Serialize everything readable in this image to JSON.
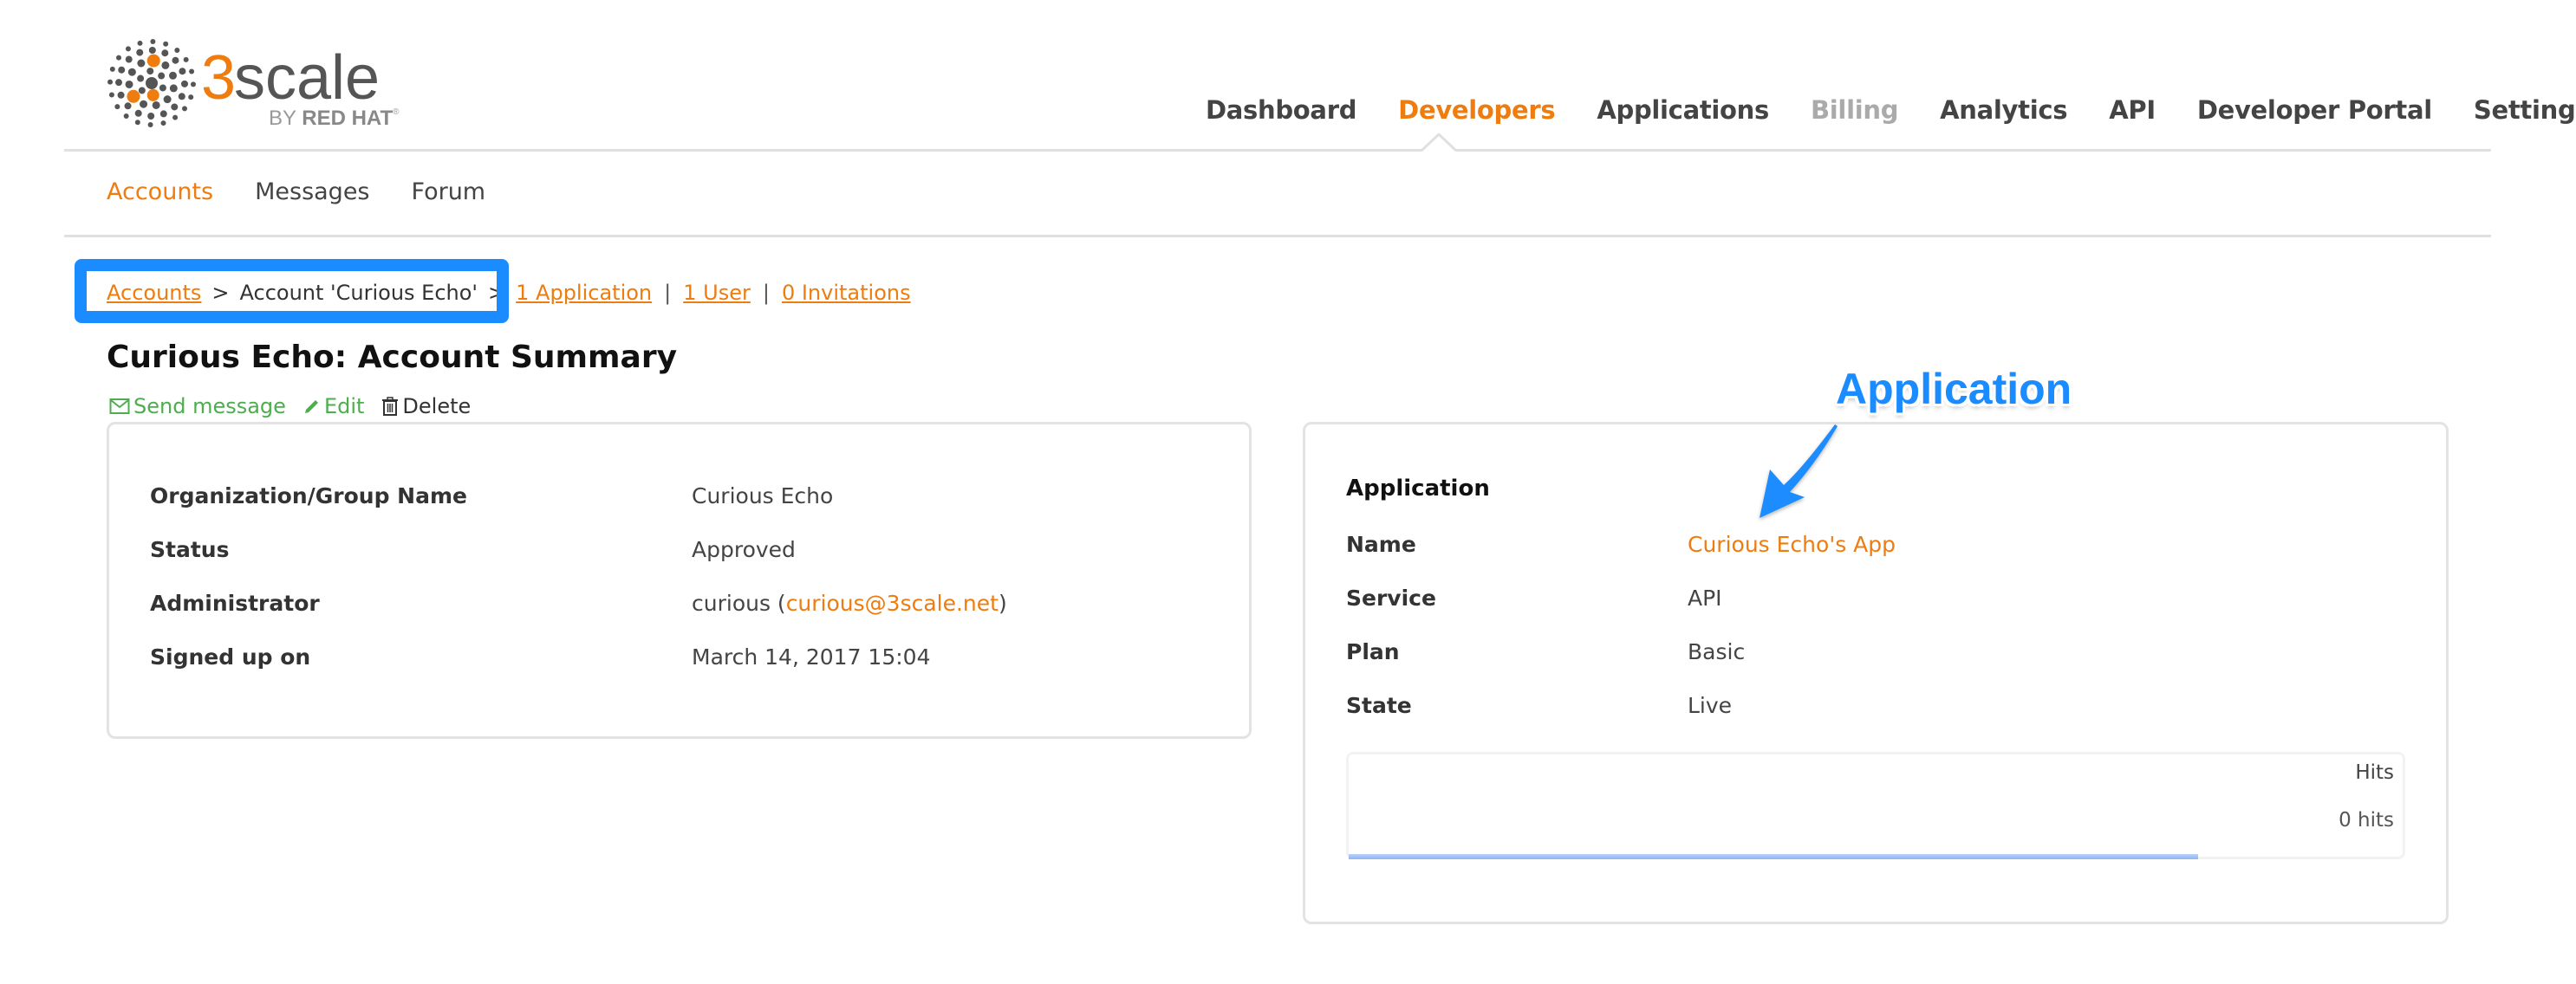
{
  "brand": {
    "name": "3scale",
    "tagline_prefix": "BY",
    "tagline": "RED HAT",
    "accent_color": "#ee7c0e",
    "logo_icon": "dots-sphere-icon"
  },
  "top_nav": {
    "items": [
      {
        "label": "Dashboard",
        "state": "normal"
      },
      {
        "label": "Developers",
        "state": "active"
      },
      {
        "label": "Applications",
        "state": "normal"
      },
      {
        "label": "Billing",
        "state": "disabled"
      },
      {
        "label": "Analytics",
        "state": "normal"
      },
      {
        "label": "API",
        "state": "normal"
      },
      {
        "label": "Developer Portal",
        "state": "normal"
      },
      {
        "label": "Settings",
        "state": "normal"
      }
    ]
  },
  "sub_nav": {
    "items": [
      {
        "label": "Accounts",
        "active": true
      },
      {
        "label": "Messages",
        "active": false
      },
      {
        "label": "Forum",
        "active": false
      }
    ]
  },
  "breadcrumb": {
    "root": "Accounts",
    "separator": ">",
    "current": "Account 'Curious Echo'",
    "links": [
      "1 Application",
      "1 User",
      "0 Invitations"
    ],
    "link_separator": "|"
  },
  "page": {
    "title": "Curious Echo: Account Summary",
    "actions": {
      "send_message": "Send message",
      "edit": "Edit",
      "delete": "Delete"
    }
  },
  "account_summary": {
    "rows": [
      {
        "label": "Organization/Group Name",
        "value": "Curious Echo"
      },
      {
        "label": "Status",
        "value": "Approved"
      },
      {
        "label": "Administrator",
        "value_prefix": "curious (",
        "value_link": "curious@3scale.net",
        "value_suffix": ")"
      },
      {
        "label": "Signed up on",
        "value": "March 14, 2017 15:04"
      }
    ]
  },
  "application_panel": {
    "heading": "Application",
    "rows": [
      {
        "label": "Name",
        "value": "Curious Echo's App",
        "is_link": true
      },
      {
        "label": "Service",
        "value": "API"
      },
      {
        "label": "Plan",
        "value": "Basic"
      },
      {
        "label": "State",
        "value": "Live"
      }
    ],
    "hits": {
      "title": "Hits",
      "value_label": "0 hits",
      "total": 0
    }
  },
  "annotation": {
    "label": "Application",
    "color": "#1a8cff"
  }
}
